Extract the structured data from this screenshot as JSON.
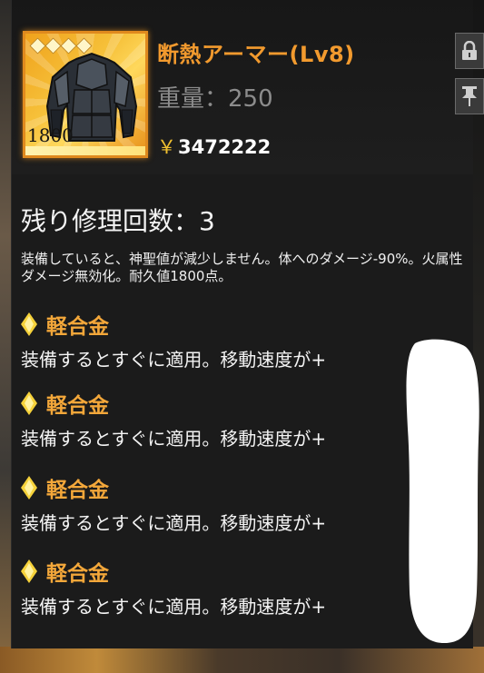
{
  "item": {
    "name": "断熱アーマー(Lv8)",
    "weight": "重量：250",
    "price_symbol": "￥",
    "price": "3472222",
    "durability": "1800",
    "rarity_stars": 4
  },
  "details": {
    "repairs": "残り修理回数：3",
    "description": "装備していると、神聖値が減少しません。体へのダメージ-90%。火属性ダメージ無効化。耐久値1800点。"
  },
  "effects": [
    {
      "title": "軽合金",
      "text": "装備するとすぐに適用。移動速度が+"
    },
    {
      "title": "軽合金",
      "text": "装備するとすぐに適用。移動速度が+"
    },
    {
      "title": "軽合金",
      "text": "装備するとすぐに適用。移動速度が+"
    },
    {
      "title": "軽合金",
      "text": "装備するとすぐに適用。移動速度が+"
    }
  ],
  "icons": {
    "lock": "lock-icon",
    "pin": "pin-icon",
    "effect": "yellow-diamond-icon"
  },
  "colors": {
    "accent_orange": "#f29a2e",
    "rarity_gold": "#f0a21c",
    "panel_bg": "#1b1b1b",
    "diamond_yellow": "#f6d23a"
  }
}
